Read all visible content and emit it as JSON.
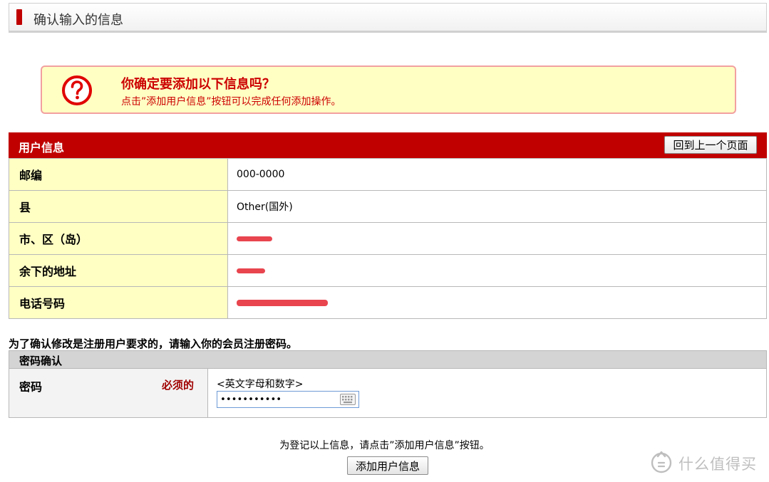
{
  "header": {
    "title": "确认输入的信息"
  },
  "confirm": {
    "title": "你确定要添加以下信息吗？",
    "description": "点击”添加用户信息”按钮可以完成任何添加操作。"
  },
  "user_info": {
    "title": "用户信息",
    "back_button": "回到上一个页面",
    "rows": [
      {
        "label": "邮编",
        "value": "000-0000"
      },
      {
        "label": "县",
        "value": "Other(国外)"
      },
      {
        "label": "市、区（岛）",
        "value": ""
      },
      {
        "label": "余下的地址",
        "value": ""
      },
      {
        "label": "电话号码",
        "value": ""
      }
    ]
  },
  "instruction": "为了确认修改是注册用户要求的，请输入你的会员注册密码。",
  "password": {
    "section_title": "密码确认",
    "label": "密码",
    "required": "必须的",
    "hint": "<英文字母和数字>",
    "value": "•••••••••••"
  },
  "footer": {
    "text": "为登记以上信息，请点击”添加用户信息”按钮。",
    "submit_button": "添加用户信息"
  },
  "watermark": {
    "text": "什么值得买"
  },
  "colors": {
    "accent_red": "#c00000",
    "confirm_bg": "#ffffc4",
    "confirm_border": "#f2a0a0",
    "redaction": "#e8454f"
  }
}
